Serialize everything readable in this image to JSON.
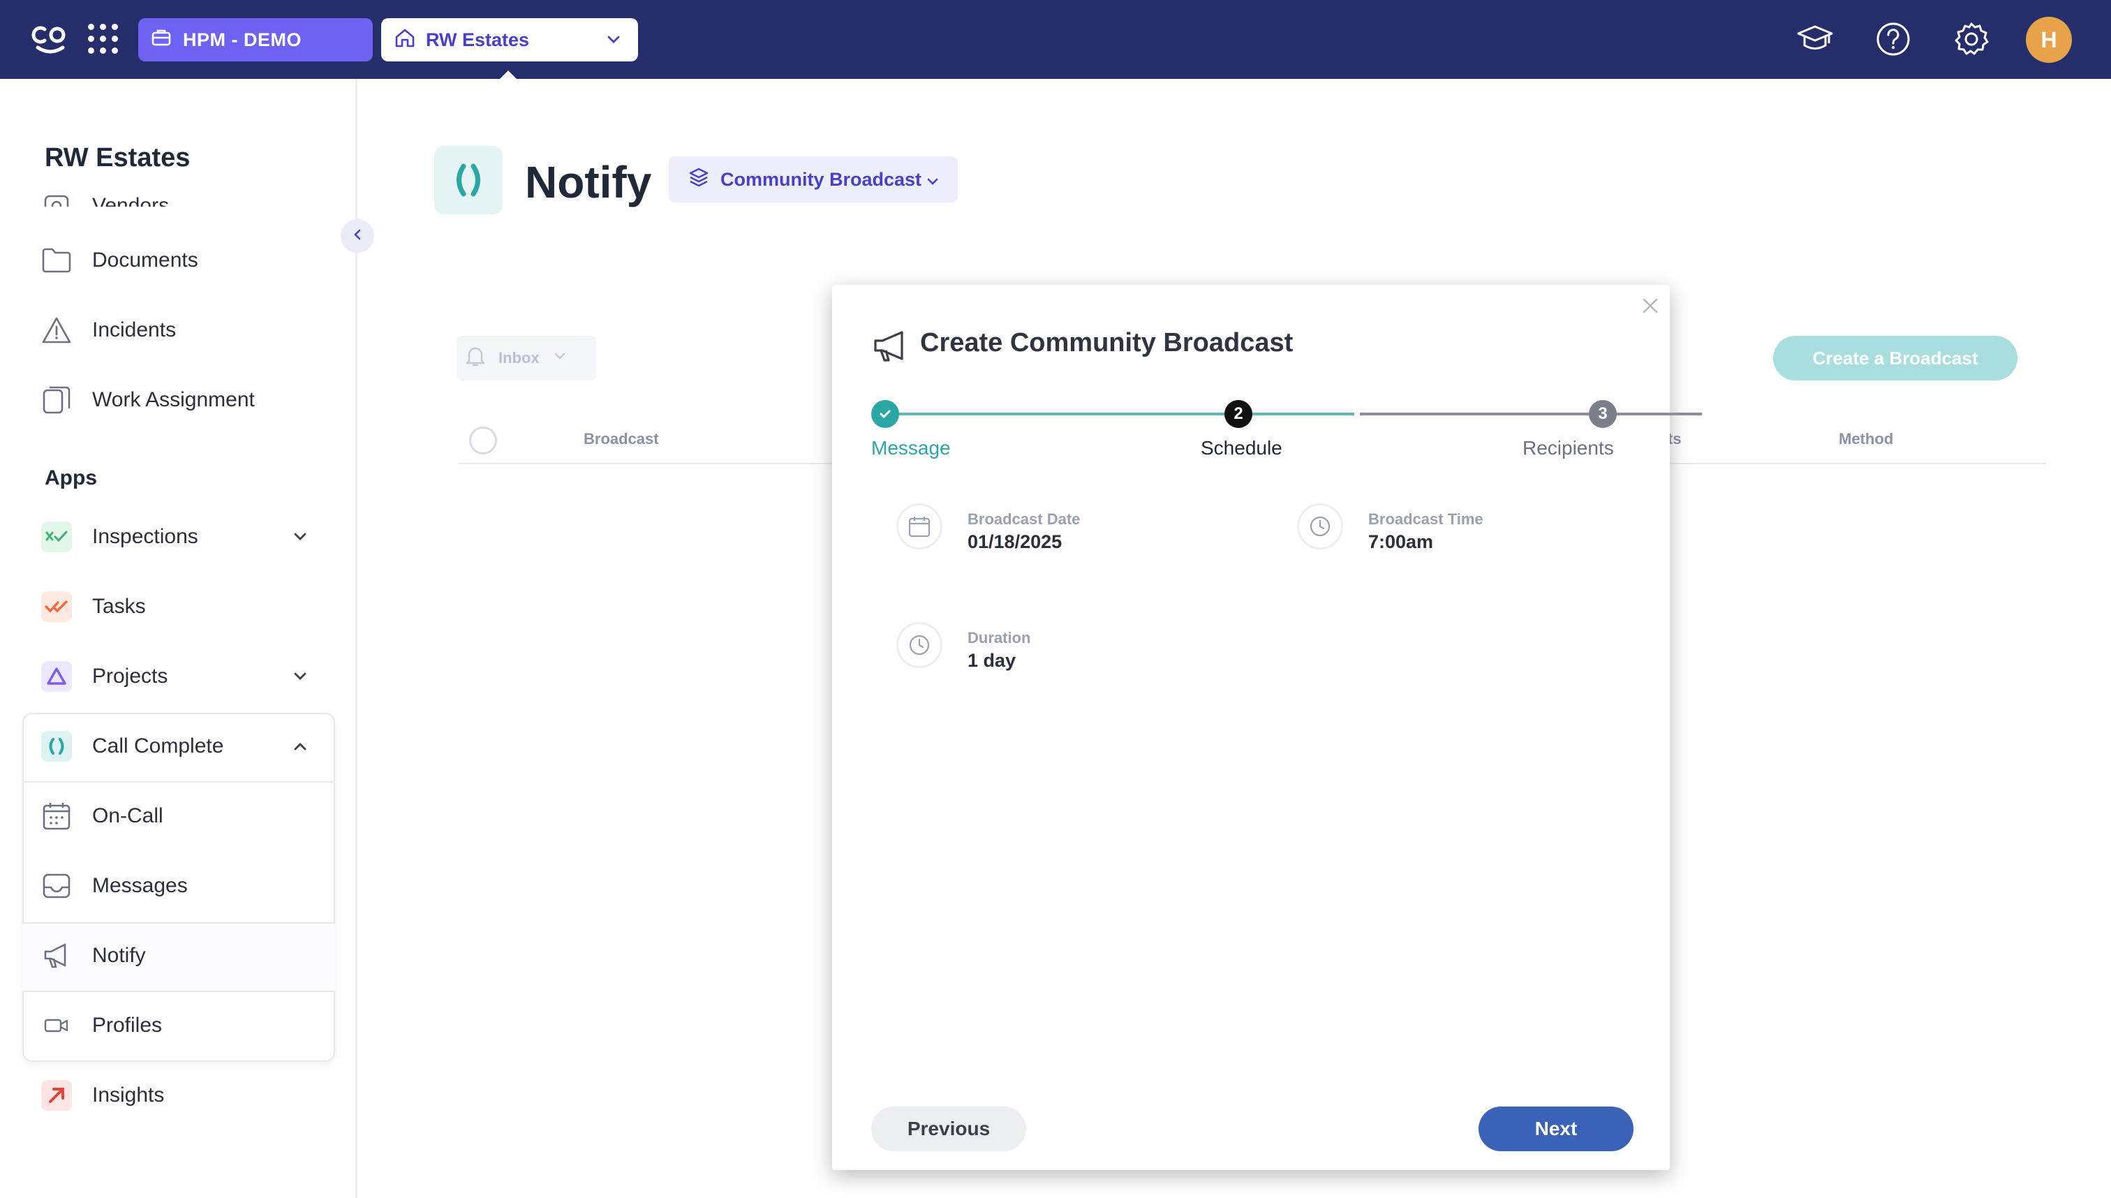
{
  "topbar": {
    "company_pill": "HPM - DEMO",
    "property_pill": "RW Estates",
    "avatar_initial": "H",
    "icons": [
      "co-logo-icon",
      "apps-grid-icon",
      "graduation-cap-icon",
      "help-icon",
      "gear-icon"
    ]
  },
  "sidebar": {
    "title": "RW Estates",
    "items": [
      {
        "label": "Vendors",
        "icon": "vendors-icon"
      },
      {
        "label": "Documents",
        "icon": "folder-icon"
      },
      {
        "label": "Incidents",
        "icon": "warning-icon"
      },
      {
        "label": "Work Assignment",
        "icon": "work-assignment-icon"
      }
    ],
    "apps_heading": "Apps",
    "apps": [
      {
        "label": "Inspections",
        "icon": "inspections-icon",
        "accent": "#3cb371"
      },
      {
        "label": "Tasks",
        "icon": "tasks-icon",
        "accent": "#ef6c3a"
      },
      {
        "label": "Projects",
        "icon": "projects-icon",
        "accent": "#7c5cf0"
      },
      {
        "label": "Call Complete",
        "icon": "call-complete-icon",
        "accent": "#2aa7a4"
      },
      {
        "label": "On-Call",
        "icon": "calendar-icon"
      },
      {
        "label": "Messages",
        "icon": "inbox-icon"
      },
      {
        "label": "Notify",
        "icon": "megaphone-icon"
      },
      {
        "label": "Profiles",
        "icon": "video-icon"
      },
      {
        "label": "Insights",
        "icon": "insights-icon",
        "accent": "#e0453b"
      }
    ]
  },
  "main": {
    "title": "Notify",
    "type_select": "Community Broadcast",
    "inbox_label": "Inbox",
    "create_button": "Create a Broadcast",
    "table_headers": {
      "broadcast": "Broadcast",
      "recipients_partial": "ts",
      "method": "Method"
    }
  },
  "modal": {
    "title": "Create Community Broadcast",
    "steps": [
      {
        "label": "Message",
        "state": "done"
      },
      {
        "label": "Schedule",
        "number": "2",
        "state": "active"
      },
      {
        "label": "Recipients",
        "number": "3",
        "state": "pending"
      }
    ],
    "fields": {
      "date": {
        "label": "Broadcast Date",
        "value": "01/18/2025"
      },
      "time": {
        "label": "Broadcast Time",
        "value": "7:00am"
      },
      "duration": {
        "label": "Duration",
        "value": "1 day"
      }
    },
    "previous_label": "Previous",
    "next_label": "Next"
  },
  "colors": {
    "topbar": "#262d6b",
    "company_pill": "#6d62f2",
    "teal": "#2aa7a4",
    "next_button": "#3a62b7",
    "create_button": "#a8dedd"
  }
}
